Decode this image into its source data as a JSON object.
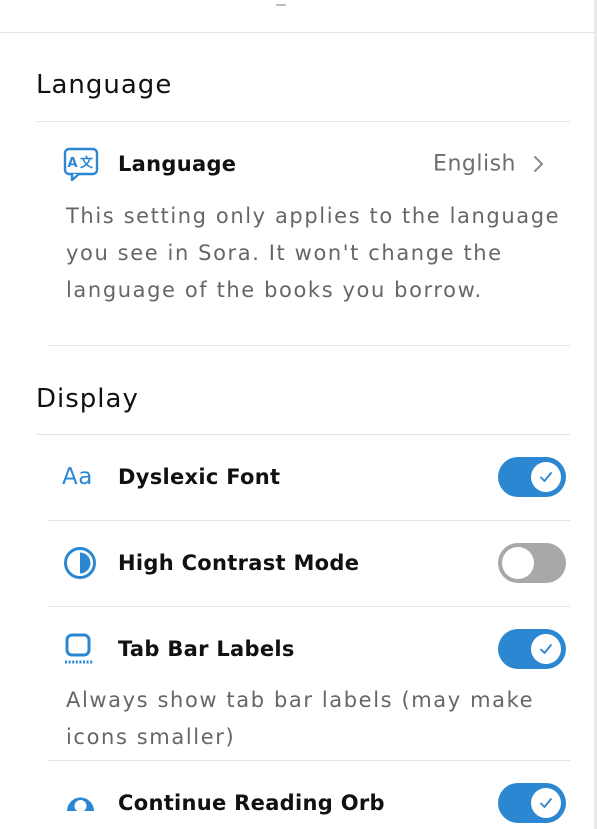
{
  "colors": {
    "accent": "#2c87d2",
    "toggle_off": "#a8a8a8",
    "muted_text": "#666666"
  },
  "sections": {
    "language": {
      "title": "Language",
      "row": {
        "icon": "translate-icon",
        "label": "Language",
        "value": "English",
        "chevron_icon": "chevron-right-icon"
      },
      "description": "This setting only applies to the language you see in Sora. It won't change the language of the books you borrow."
    },
    "display": {
      "title": "Display",
      "rows": [
        {
          "icon": "font-aa-icon",
          "icon_text": "Aa",
          "label": "Dyslexic Font",
          "toggle": "on"
        },
        {
          "icon": "contrast-icon",
          "label": "High Contrast Mode",
          "toggle": "off"
        },
        {
          "icon": "tab-bar-labels-icon",
          "label": "Tab Bar Labels",
          "toggle": "on",
          "description": "Always show tab bar labels (may make icons smaller)"
        },
        {
          "icon": "orb-icon",
          "label": "Continue Reading Orb",
          "toggle": "on"
        }
      ]
    }
  }
}
